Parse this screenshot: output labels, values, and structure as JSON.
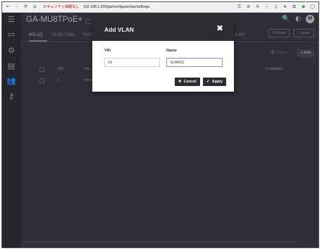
{
  "browser": {
    "security_label": "セキュリティ保護なし",
    "url": "192.168.1.200/gui/configure/vlanSettings",
    "nav": {
      "back": "←",
      "forward": "→",
      "reload": "⟳",
      "home": "⌂"
    },
    "toolbar_icons": [
      "key-icon",
      "zoom-icon",
      "read-aloud-icon",
      "favorite-icon",
      "split-screen-icon",
      "favorites-bar-icon",
      "collections-icon",
      "extension-icon",
      "profile-icon"
    ]
  },
  "app": {
    "model": "GA-MU8TPoE+",
    "sidebar_icons": [
      "menu-icon",
      "monitor-icon",
      "gear-icon",
      "list-icon",
      "users-icon",
      "key-icon"
    ],
    "tabs": [
      "802.1Q",
      "VLAN Table",
      "PVID"
    ],
    "tab_right": "VLAN",
    "top_buttons": {
      "reset": "⟳ Reset",
      "apply": "✓ Apply"
    },
    "actions": {
      "delete": "🗑 Delete",
      "add": "+ Add"
    },
    "table": {
      "headers": {
        "vid": "VID",
        "name": "Na",
        "forbidden": "Forbidden"
      },
      "row": {
        "vid": "1",
        "name": "defa"
      }
    }
  },
  "modal": {
    "title": "Add VLAN",
    "close": "✖",
    "vid_label": "VID",
    "vid_value": "10",
    "name_label": "Name",
    "name_value": "VLAN10",
    "cancel": "Cancel",
    "apply": "Apply"
  }
}
